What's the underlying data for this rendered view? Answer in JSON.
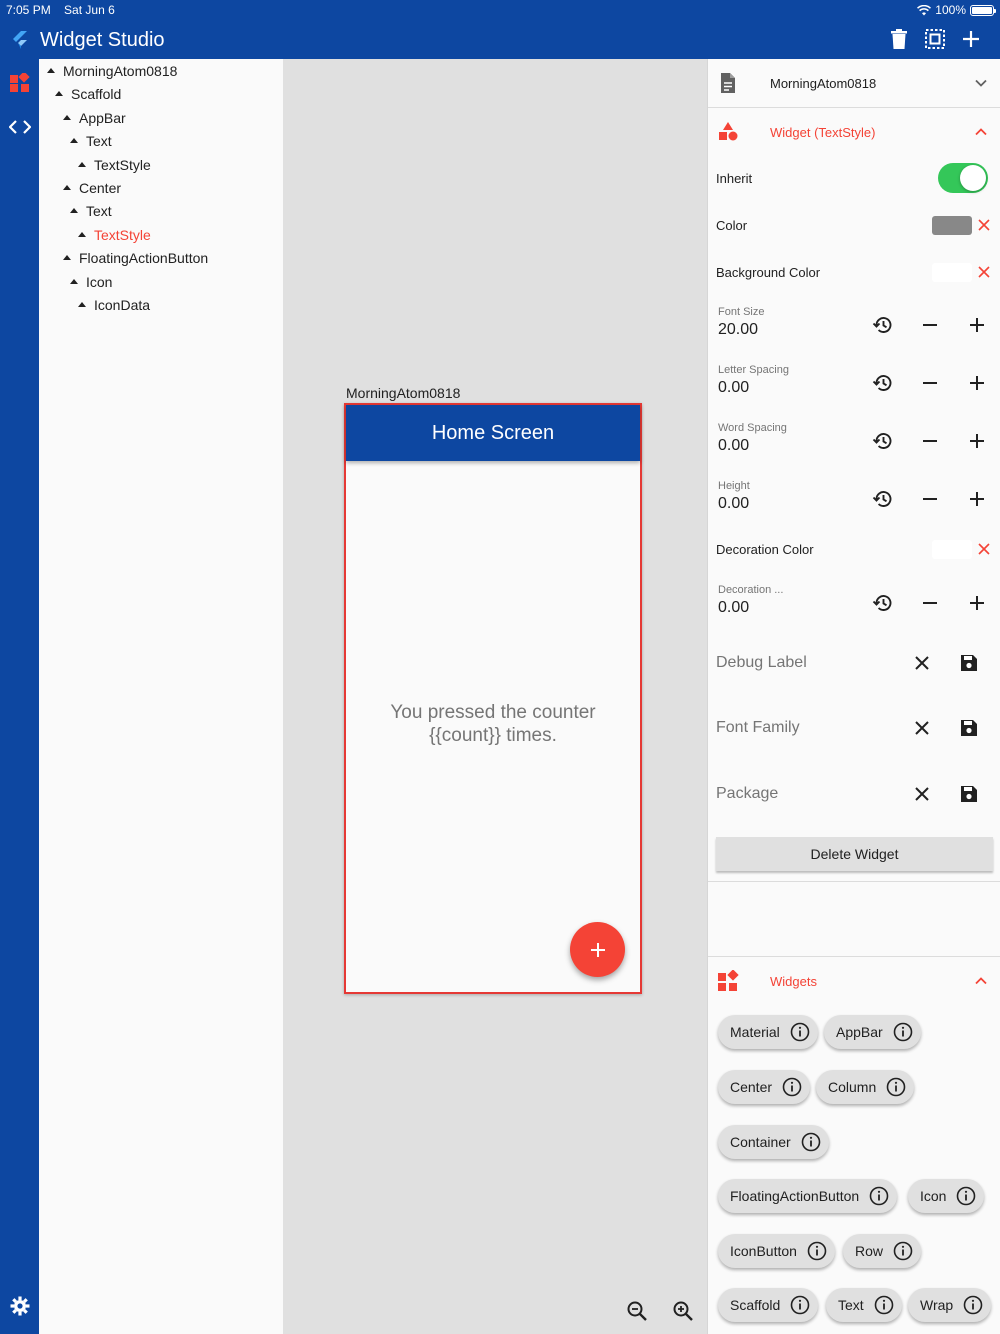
{
  "status": {
    "time": "7:05 PM",
    "date": "Sat Jun 6",
    "battery": "100%"
  },
  "app": {
    "title": "Widget Studio"
  },
  "colors": {
    "primary": "#0d47a1",
    "accent": "#f44336",
    "toggle_on": "#34c759"
  },
  "tree": {
    "nodes": [
      {
        "label": "MorningAtom0818"
      },
      {
        "label": "Scaffold"
      },
      {
        "label": "AppBar"
      },
      {
        "label": "Text"
      },
      {
        "label": "TextStyle"
      },
      {
        "label": "Center"
      },
      {
        "label": "Text"
      },
      {
        "label": "TextStyle",
        "selected": true
      },
      {
        "label": "FloatingActionButton"
      },
      {
        "label": "Icon"
      },
      {
        "label": "IconData"
      }
    ]
  },
  "canvas": {
    "frame_label": "MorningAtom0818",
    "appbar_title": "Home Screen",
    "body_line1": "You pressed the counter",
    "body_line2": "{{count}} times.",
    "fab_icon": "plus-icon"
  },
  "panel": {
    "file_name": "MorningAtom0818",
    "widget_title": "Widget (TextStyle)",
    "inherit_label": "Inherit",
    "inherit_value": true,
    "color_label": "Color",
    "color_value": "#888888",
    "bg_color_label": "Background Color",
    "font_size_label": "Font Size",
    "font_size_value": "20.00",
    "letter_spacing_label": "Letter Spacing",
    "letter_spacing_value": "0.00",
    "word_spacing_label": "Word Spacing",
    "word_spacing_value": "0.00",
    "height_label": "Height",
    "height_value": "0.00",
    "decoration_color_label": "Decoration Color",
    "decoration_thickness_label": "Decoration ...",
    "decoration_thickness_value": "0.00",
    "debug_label": "Debug Label",
    "font_family_label": "Font Family",
    "package_label": "Package",
    "delete_label": "Delete Widget",
    "widgets_title": "Widgets",
    "widgets": [
      "Material",
      "AppBar",
      "Center",
      "Column",
      "Container",
      "FloatingActionButton",
      "Icon",
      "IconButton",
      "Row",
      "Scaffold",
      "Text",
      "Wrap"
    ]
  }
}
